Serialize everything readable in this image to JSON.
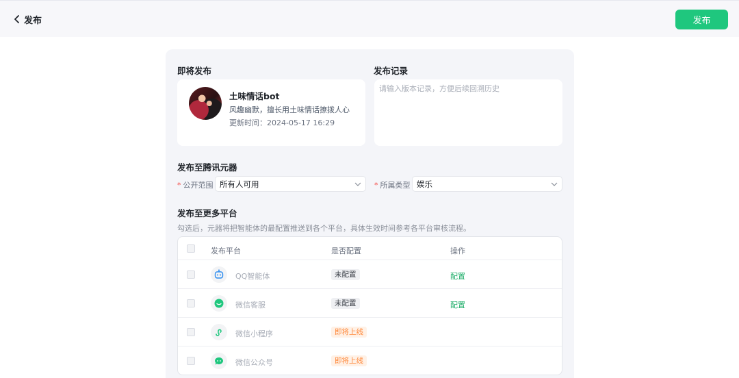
{
  "header": {
    "back_label": "发布",
    "publish_button": "发布"
  },
  "upcoming": {
    "title": "即将发布",
    "bot_name": "土味情话bot",
    "bot_desc": "风趣幽默，擅长用土味情话撩拨人心",
    "update_time": "更新时间：2024-05-17 16:29"
  },
  "record": {
    "title": "发布记录",
    "placeholder": "请输入版本记录，方便后续回溯历史"
  },
  "tencent": {
    "title": "发布至腾讯元器",
    "scope_label": "公开范围",
    "scope_value": "所有人可用",
    "category_label": "所属类型",
    "category_value": "娱乐"
  },
  "more": {
    "title": "发布至更多平台",
    "hint": "勾选后，元器将把智能体的最配置推送到各个平台，具体生效时间参考各平台审核流程。",
    "columns": [
      "发布平台",
      "是否配置",
      "操作"
    ],
    "platforms": [
      {
        "name": "QQ智能体",
        "status": "未配置",
        "action": "配置",
        "icon": "qq-bot-icon"
      },
      {
        "name": "微信客服",
        "status": "未配置",
        "action": "配置",
        "icon": "wechat-service-icon"
      },
      {
        "name": "微信小程序",
        "status": "即将上线",
        "action": "",
        "icon": "mini-program-icon"
      },
      {
        "name": "微信公众号",
        "status": "即将上线",
        "action": "",
        "icon": "wechat-official-icon"
      }
    ]
  },
  "colors": {
    "accent": "#1fc77e",
    "link": "#1fae6a",
    "soon": "#ff8a3d",
    "required": "#f54a45"
  }
}
